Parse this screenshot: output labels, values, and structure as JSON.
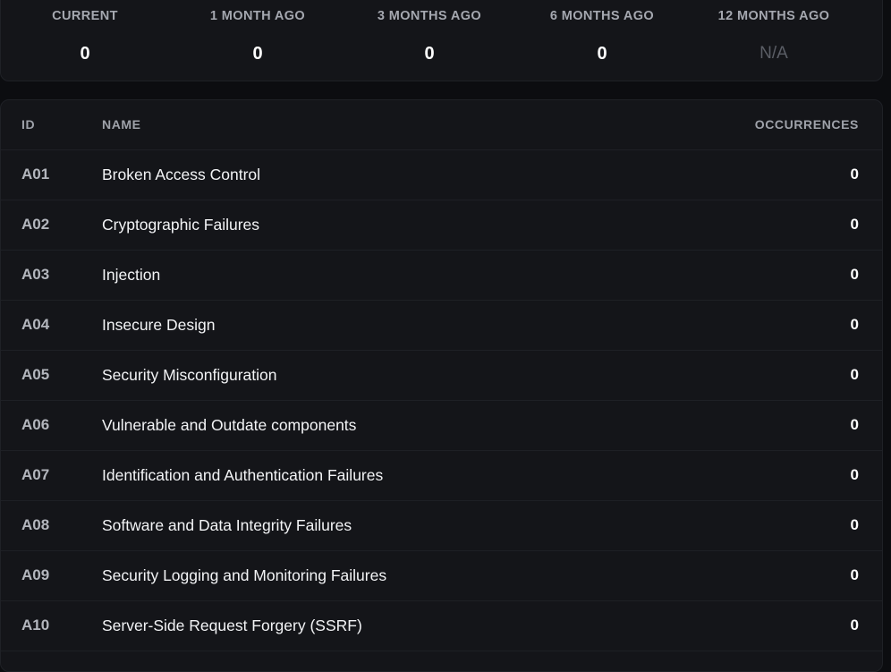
{
  "stats": [
    {
      "label": "CURRENT",
      "value": "0"
    },
    {
      "label": "1 MONTH AGO",
      "value": "0"
    },
    {
      "label": "3 MONTHS AGO",
      "value": "0"
    },
    {
      "label": "6 MONTHS AGO",
      "value": "0"
    },
    {
      "label": "12 MONTHS AGO",
      "value": "N/A"
    }
  ],
  "table": {
    "headers": {
      "id": "ID",
      "name": "NAME",
      "occurrences": "OCCURRENCES"
    },
    "rows": [
      {
        "id": "A01",
        "name": "Broken Access Control",
        "occurrences": "0"
      },
      {
        "id": "A02",
        "name": "Cryptographic Failures",
        "occurrences": "0"
      },
      {
        "id": "A03",
        "name": "Injection",
        "occurrences": "0"
      },
      {
        "id": "A04",
        "name": "Insecure Design",
        "occurrences": "0"
      },
      {
        "id": "A05",
        "name": "Security Misconfiguration",
        "occurrences": "0"
      },
      {
        "id": "A06",
        "name": "Vulnerable and Outdate components",
        "occurrences": "0"
      },
      {
        "id": "A07",
        "name": "Identification and Authentication Failures",
        "occurrences": "0"
      },
      {
        "id": "A08",
        "name": "Software and Data Integrity Failures",
        "occurrences": "0"
      },
      {
        "id": "A09",
        "name": "Security Logging and Monitoring Failures",
        "occurrences": "0"
      },
      {
        "id": "A10",
        "name": "Server-Side Request Forgery (SSRF)",
        "occurrences": "0"
      }
    ]
  }
}
